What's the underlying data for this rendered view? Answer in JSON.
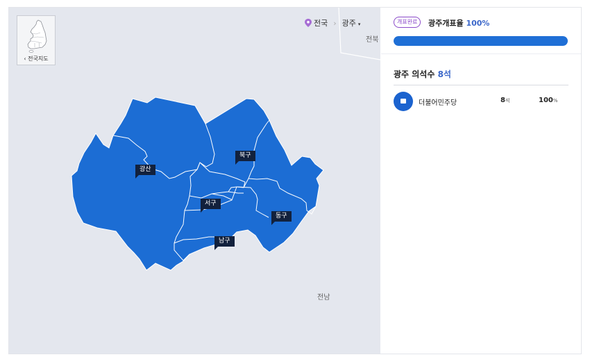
{
  "map": {
    "minimap": {
      "label": "‹ 전국지도"
    },
    "breadcrumb": {
      "level1": "전국",
      "level2": "광주"
    },
    "neighbors": {
      "north": "전북",
      "south": "전남"
    },
    "districts": [
      "광산",
      "북구",
      "서구",
      "동구",
      "남구"
    ],
    "colors": {
      "winner": "#1c6dd4",
      "background": "#e4e7ee",
      "label_bg": "#12213d"
    }
  },
  "panel": {
    "badge": "개표완료",
    "rate_label": "광주개표율",
    "rate_value": "100%",
    "rate_fraction": 1.0,
    "seats_label": "광주 의석수",
    "seats_value": "8석",
    "parties": [
      {
        "name": "더불어민주당",
        "seats": "8",
        "seats_unit": "석",
        "pct": "100",
        "pct_unit": "%",
        "color": "#1b63cf"
      }
    ]
  }
}
